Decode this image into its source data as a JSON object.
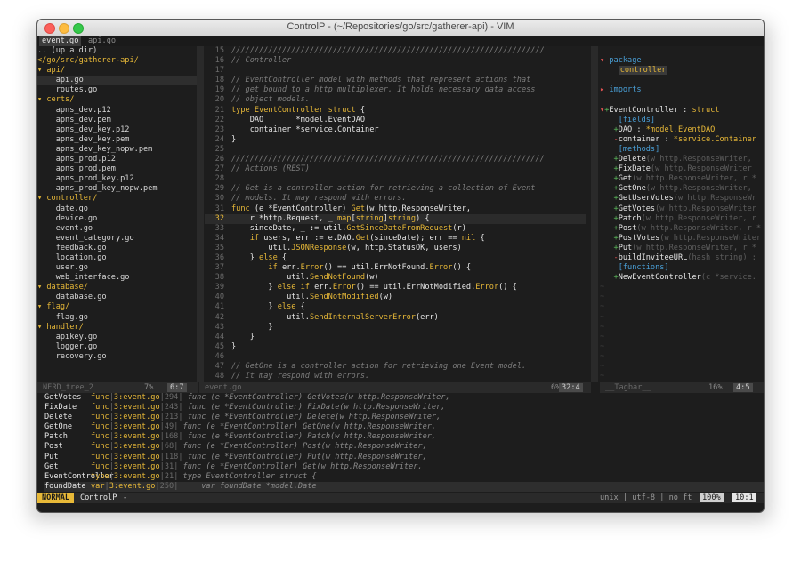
{
  "window": {
    "title": "ControlP - (~/Repositories/go/src/gatherer-api) - VIM"
  },
  "tabs": [
    {
      "label": "event.go",
      "active": true
    },
    {
      "label": "api.go",
      "active": false
    }
  ],
  "tree": {
    "status": {
      "name": "NERD_tree_2",
      "percent": "7%",
      "position": "6:7"
    },
    "rows": [
      {
        "text": ".. (up a dir)",
        "kind": "file"
      },
      {
        "text": "</go/src/gatherer-api/",
        "kind": "root"
      },
      {
        "text": "▾ api/",
        "kind": "dir"
      },
      {
        "text": "    api.go",
        "kind": "file",
        "highlight": true
      },
      {
        "text": "    routes.go",
        "kind": "file"
      },
      {
        "text": "▾ certs/",
        "kind": "dir"
      },
      {
        "text": "    apns_dev.p12",
        "kind": "file"
      },
      {
        "text": "    apns_dev.pem",
        "kind": "file"
      },
      {
        "text": "    apns_dev_key.p12",
        "kind": "file"
      },
      {
        "text": "    apns_dev_key.pem",
        "kind": "file"
      },
      {
        "text": "    apns_dev_key_nopw.pem",
        "kind": "file"
      },
      {
        "text": "    apns_prod.p12",
        "kind": "file"
      },
      {
        "text": "    apns_prod.pem",
        "kind": "file"
      },
      {
        "text": "    apns_prod_key.p12",
        "kind": "file"
      },
      {
        "text": "    apns_prod_key_nopw.pem",
        "kind": "file"
      },
      {
        "text": "▾ controller/",
        "kind": "dir"
      },
      {
        "text": "    date.go",
        "kind": "file"
      },
      {
        "text": "    device.go",
        "kind": "file"
      },
      {
        "text": "    event.go",
        "kind": "file"
      },
      {
        "text": "    event_category.go",
        "kind": "file"
      },
      {
        "text": "    feedback.go",
        "kind": "file"
      },
      {
        "text": "    location.go",
        "kind": "file"
      },
      {
        "text": "    user.go",
        "kind": "file"
      },
      {
        "text": "    web_interface.go",
        "kind": "file"
      },
      {
        "text": "▾ database/",
        "kind": "dir"
      },
      {
        "text": "    database.go",
        "kind": "file"
      },
      {
        "text": "▾ flag/",
        "kind": "dir"
      },
      {
        "text": "    flag.go",
        "kind": "file"
      },
      {
        "text": "▾ handler/",
        "kind": "dir"
      },
      {
        "text": "    apikey.go",
        "kind": "file"
      },
      {
        "text": "    logger.go",
        "kind": "file"
      },
      {
        "text": "    recovery.go",
        "kind": "file"
      }
    ]
  },
  "code": {
    "status": {
      "name": "event.go",
      "percent": "6%",
      "position": "32:4"
    },
    "current_line": "32",
    "lines": [
      {
        "n": "15",
        "parts": [
          [
            "cmt",
            "////////////////////////////////////////////////////////////////////"
          ]
        ]
      },
      {
        "n": "16",
        "parts": [
          [
            "cmt",
            "// Controller"
          ]
        ]
      },
      {
        "n": "17",
        "parts": []
      },
      {
        "n": "18",
        "parts": [
          [
            "cmt",
            "// EventController model with methods that represent actions that"
          ]
        ]
      },
      {
        "n": "19",
        "parts": [
          [
            "cmt",
            "// get bound to a http multiplexer. It holds necessary data access"
          ]
        ]
      },
      {
        "n": "20",
        "parts": [
          [
            "cmt",
            "// object models."
          ]
        ]
      },
      {
        "n": "21",
        "parts": [
          [
            "kw",
            "type "
          ],
          [
            "fn",
            "EventController "
          ],
          [
            "kw",
            "struct"
          ],
          [
            "txt",
            " {"
          ]
        ]
      },
      {
        "n": "22",
        "parts": [
          [
            "txt",
            "    DAO       *model.EventDAO"
          ]
        ]
      },
      {
        "n": "23",
        "parts": [
          [
            "txt",
            "    container *service.Container"
          ]
        ]
      },
      {
        "n": "24",
        "parts": [
          [
            "txt",
            "}"
          ]
        ]
      },
      {
        "n": "25",
        "parts": []
      },
      {
        "n": "26",
        "parts": [
          [
            "cmt",
            "////////////////////////////////////////////////////////////////////"
          ]
        ]
      },
      {
        "n": "27",
        "parts": [
          [
            "cmt",
            "// Actions (REST)"
          ]
        ]
      },
      {
        "n": "28",
        "parts": []
      },
      {
        "n": "29",
        "parts": [
          [
            "cmt",
            "// Get is a controller action for retrieving a collection of Event"
          ]
        ]
      },
      {
        "n": "30",
        "parts": [
          [
            "cmt",
            "// models. It may respond with errors."
          ]
        ]
      },
      {
        "n": "31",
        "parts": [
          [
            "kw",
            "func"
          ],
          [
            "txt",
            " (e *EventController) "
          ],
          [
            "fn",
            "Get"
          ],
          [
            "txt",
            "(w http.ResponseWriter,"
          ]
        ]
      },
      {
        "n": "32",
        "parts": [
          [
            "txt",
            "    r *http.Request, _ "
          ],
          [
            "kw",
            "map"
          ],
          [
            "txt",
            "["
          ],
          [
            "kw",
            "string"
          ],
          [
            "txt",
            "]"
          ],
          [
            "kw",
            "string"
          ],
          [
            "txt",
            ") {"
          ]
        ]
      },
      {
        "n": "33",
        "parts": [
          [
            "txt",
            "    sinceDate, _ := util."
          ],
          [
            "fn",
            "GetSinceDateFromRequest"
          ],
          [
            "txt",
            "(r)"
          ]
        ]
      },
      {
        "n": "34",
        "parts": [
          [
            "txt",
            "    "
          ],
          [
            "kw",
            "if"
          ],
          [
            "txt",
            " users, err := e.DAO."
          ],
          [
            "fn",
            "Get"
          ],
          [
            "txt",
            "(sinceDate); err == "
          ],
          [
            "kw",
            "nil"
          ],
          [
            "txt",
            " {"
          ]
        ]
      },
      {
        "n": "35",
        "parts": [
          [
            "txt",
            "        util."
          ],
          [
            "fn",
            "JSONResponse"
          ],
          [
            "txt",
            "(w, http.StatusOK, users)"
          ]
        ]
      },
      {
        "n": "36",
        "parts": [
          [
            "txt",
            "    } "
          ],
          [
            "kw",
            "else"
          ],
          [
            "txt",
            " {"
          ]
        ]
      },
      {
        "n": "37",
        "parts": [
          [
            "txt",
            "        "
          ],
          [
            "kw",
            "if"
          ],
          [
            "txt",
            " err."
          ],
          [
            "fn",
            "Error"
          ],
          [
            "txt",
            "() == util.ErrNotFound."
          ],
          [
            "fn",
            "Error"
          ],
          [
            "txt",
            "() {"
          ]
        ]
      },
      {
        "n": "38",
        "parts": [
          [
            "txt",
            "            util."
          ],
          [
            "fn",
            "SendNotFound"
          ],
          [
            "txt",
            "(w)"
          ]
        ]
      },
      {
        "n": "39",
        "parts": [
          [
            "txt",
            "        } "
          ],
          [
            "kw",
            "else if"
          ],
          [
            "txt",
            " err."
          ],
          [
            "fn",
            "Error"
          ],
          [
            "txt",
            "() == util.ErrNotModified."
          ],
          [
            "fn",
            "Error"
          ],
          [
            "txt",
            "() {"
          ]
        ]
      },
      {
        "n": "40",
        "parts": [
          [
            "txt",
            "            util."
          ],
          [
            "fn",
            "SendNotModified"
          ],
          [
            "txt",
            "(w)"
          ]
        ]
      },
      {
        "n": "41",
        "parts": [
          [
            "txt",
            "        } "
          ],
          [
            "kw",
            "else"
          ],
          [
            "txt",
            " {"
          ]
        ]
      },
      {
        "n": "42",
        "parts": [
          [
            "txt",
            "            util."
          ],
          [
            "fn",
            "SendInternalServerError"
          ],
          [
            "txt",
            "(err)"
          ]
        ]
      },
      {
        "n": "43",
        "parts": [
          [
            "txt",
            "        }"
          ]
        ]
      },
      {
        "n": "44",
        "parts": [
          [
            "txt",
            "    }"
          ]
        ]
      },
      {
        "n": "45",
        "parts": [
          [
            "txt",
            "}"
          ]
        ]
      },
      {
        "n": "46",
        "parts": []
      },
      {
        "n": "47",
        "parts": [
          [
            "cmt",
            "// GetOne is a controller action for retrieving one Event model."
          ]
        ]
      },
      {
        "n": "48",
        "parts": [
          [
            "cmt",
            "// It may respond with errors."
          ]
        ]
      }
    ]
  },
  "tagbar": {
    "status": {
      "name": "__Tagbar__",
      "percent": "16%",
      "position": "4:5"
    },
    "rows": [
      {
        "parts": []
      },
      {
        "parts": [
          [
            "minus",
            "▾ "
          ],
          [
            "label",
            "package"
          ]
        ]
      },
      {
        "parts": [
          [
            "txt",
            "    "
          ],
          [
            "sel",
            "controller"
          ]
        ]
      },
      {
        "parts": []
      },
      {
        "parts": [
          [
            "minus",
            "▸ "
          ],
          [
            "label",
            "imports"
          ]
        ]
      },
      {
        "parts": []
      },
      {
        "parts": [
          [
            "minus",
            "▾"
          ],
          [
            "plus",
            "+"
          ],
          [
            "name",
            "EventController : "
          ],
          [
            "kw",
            "struct"
          ]
        ]
      },
      {
        "parts": [
          [
            "label",
            "    [fields]"
          ]
        ]
      },
      {
        "parts": [
          [
            "plus",
            "   +"
          ],
          [
            "name",
            "DAO : "
          ],
          [
            "kw",
            "*model.EventDAO"
          ]
        ]
      },
      {
        "parts": [
          [
            "minus",
            "   -"
          ],
          [
            "name",
            "container : "
          ],
          [
            "kw",
            "*service.Container"
          ]
        ]
      },
      {
        "parts": [
          [
            "label",
            "    [methods]"
          ]
        ]
      },
      {
        "parts": [
          [
            "plus",
            "   +"
          ],
          [
            "name",
            "Delete"
          ],
          [
            "sig",
            "(w http.ResponseWriter, "
          ]
        ]
      },
      {
        "parts": [
          [
            "plus",
            "   +"
          ],
          [
            "name",
            "FixDate"
          ],
          [
            "sig",
            "(w http.ResponseWriter"
          ]
        ]
      },
      {
        "parts": [
          [
            "plus",
            "   +"
          ],
          [
            "name",
            "Get"
          ],
          [
            "sig",
            "(w http.ResponseWriter, r *"
          ]
        ]
      },
      {
        "parts": [
          [
            "plus",
            "   +"
          ],
          [
            "name",
            "GetOne"
          ],
          [
            "sig",
            "(w http.ResponseWriter, "
          ]
        ]
      },
      {
        "parts": [
          [
            "plus",
            "   +"
          ],
          [
            "name",
            "GetUserVotes"
          ],
          [
            "sig",
            "(w http.ResponseWr"
          ]
        ]
      },
      {
        "parts": [
          [
            "plus",
            "   +"
          ],
          [
            "name",
            "GetVotes"
          ],
          [
            "sig",
            "(w http.ResponseWriter"
          ]
        ]
      },
      {
        "parts": [
          [
            "plus",
            "   +"
          ],
          [
            "name",
            "Patch"
          ],
          [
            "sig",
            "(w http.ResponseWriter, r"
          ]
        ]
      },
      {
        "parts": [
          [
            "plus",
            "   +"
          ],
          [
            "name",
            "Post"
          ],
          [
            "sig",
            "(w http.ResponseWriter, r *"
          ]
        ]
      },
      {
        "parts": [
          [
            "plus",
            "   +"
          ],
          [
            "name",
            "PostVotes"
          ],
          [
            "sig",
            "(w http.ResponseWriter"
          ]
        ]
      },
      {
        "parts": [
          [
            "plus",
            "   +"
          ],
          [
            "name",
            "Put"
          ],
          [
            "sig",
            "(w http.ResponseWriter, r *"
          ]
        ]
      },
      {
        "parts": [
          [
            "minus",
            "   -"
          ],
          [
            "name",
            "buildInviteeURL"
          ],
          [
            "sig",
            "(hash string) :"
          ]
        ]
      },
      {
        "parts": [
          [
            "label",
            "    [functions]"
          ]
        ]
      },
      {
        "parts": [
          [
            "plus",
            "   +"
          ],
          [
            "name",
            "NewEventController"
          ],
          [
            "sig",
            "(c *service."
          ]
        ]
      },
      {
        "parts": [
          [
            "tilde",
            "~"
          ]
        ]
      },
      {
        "parts": [
          [
            "tilde",
            "~"
          ]
        ]
      },
      {
        "parts": [
          [
            "tilde",
            "~"
          ]
        ]
      },
      {
        "parts": [
          [
            "tilde",
            "~"
          ]
        ]
      },
      {
        "parts": [
          [
            "tilde",
            "~"
          ]
        ]
      },
      {
        "parts": [
          [
            "tilde",
            "~"
          ]
        ]
      },
      {
        "parts": [
          [
            "tilde",
            "~"
          ]
        ]
      },
      {
        "parts": [
          [
            "tilde",
            "~"
          ]
        ]
      },
      {
        "parts": [
          [
            "tilde",
            "~"
          ]
        ]
      },
      {
        "parts": [
          [
            "tilde",
            "~"
          ]
        ]
      }
    ]
  },
  "ctrlp": {
    "rows": [
      {
        "name": "GetVotes",
        "kind": "func",
        "file": "3:event.go",
        "line": "294",
        "code": "func (e *EventController) GetVotes(w http.ResponseWriter,"
      },
      {
        "name": "FixDate",
        "kind": "func",
        "file": "3:event.go",
        "line": "243",
        "code": "func (e *EventController) FixDate(w http.ResponseWriter,"
      },
      {
        "name": "Delete",
        "kind": "func",
        "file": "3:event.go",
        "line": "213",
        "code": "func (e *EventController) Delete(w http.ResponseWriter,"
      },
      {
        "name": "GetOne",
        "kind": "func",
        "file": "3:event.go",
        "line": "49",
        "code": "func (e *EventController) GetOne(w http.ResponseWriter,"
      },
      {
        "name": "Patch",
        "kind": "func",
        "file": "3:event.go",
        "line": "168",
        "code": "func (e *EventController) Patch(w http.ResponseWriter,"
      },
      {
        "name": "Post",
        "kind": "func",
        "file": "3:event.go",
        "line": "68",
        "code": "func (e *EventController) Post(w http.ResponseWriter,"
      },
      {
        "name": "Put",
        "kind": "func",
        "file": "3:event.go",
        "line": "118",
        "code": "func (e *EventController) Put(w http.ResponseWriter,"
      },
      {
        "name": "Get",
        "kind": "func",
        "file": "3:event.go",
        "line": "31",
        "code": "func (e *EventController) Get(w http.ResponseWriter,"
      },
      {
        "name": "EventController",
        "kind": "type",
        "file": "3:event.go",
        "line": "21",
        "code": "type EventController struct {"
      },
      {
        "name": "foundDate",
        "kind": "var",
        "file": "3:event.go",
        "line": "250",
        "code": "    var foundDate *model.Date",
        "current": true
      }
    ]
  },
  "bottom": {
    "mode": "NORMAL",
    "name": "ControlP",
    "minus": "-",
    "format": "unix | utf-8 | no ft",
    "percent": "100%",
    "position": "10:1"
  },
  "colors": {
    "accent": "#e8b938",
    "background": "#1d1d1d",
    "tag_head": "#e05252",
    "tag_label": "#4aa0d8",
    "tag_public": "#5ab75a"
  }
}
